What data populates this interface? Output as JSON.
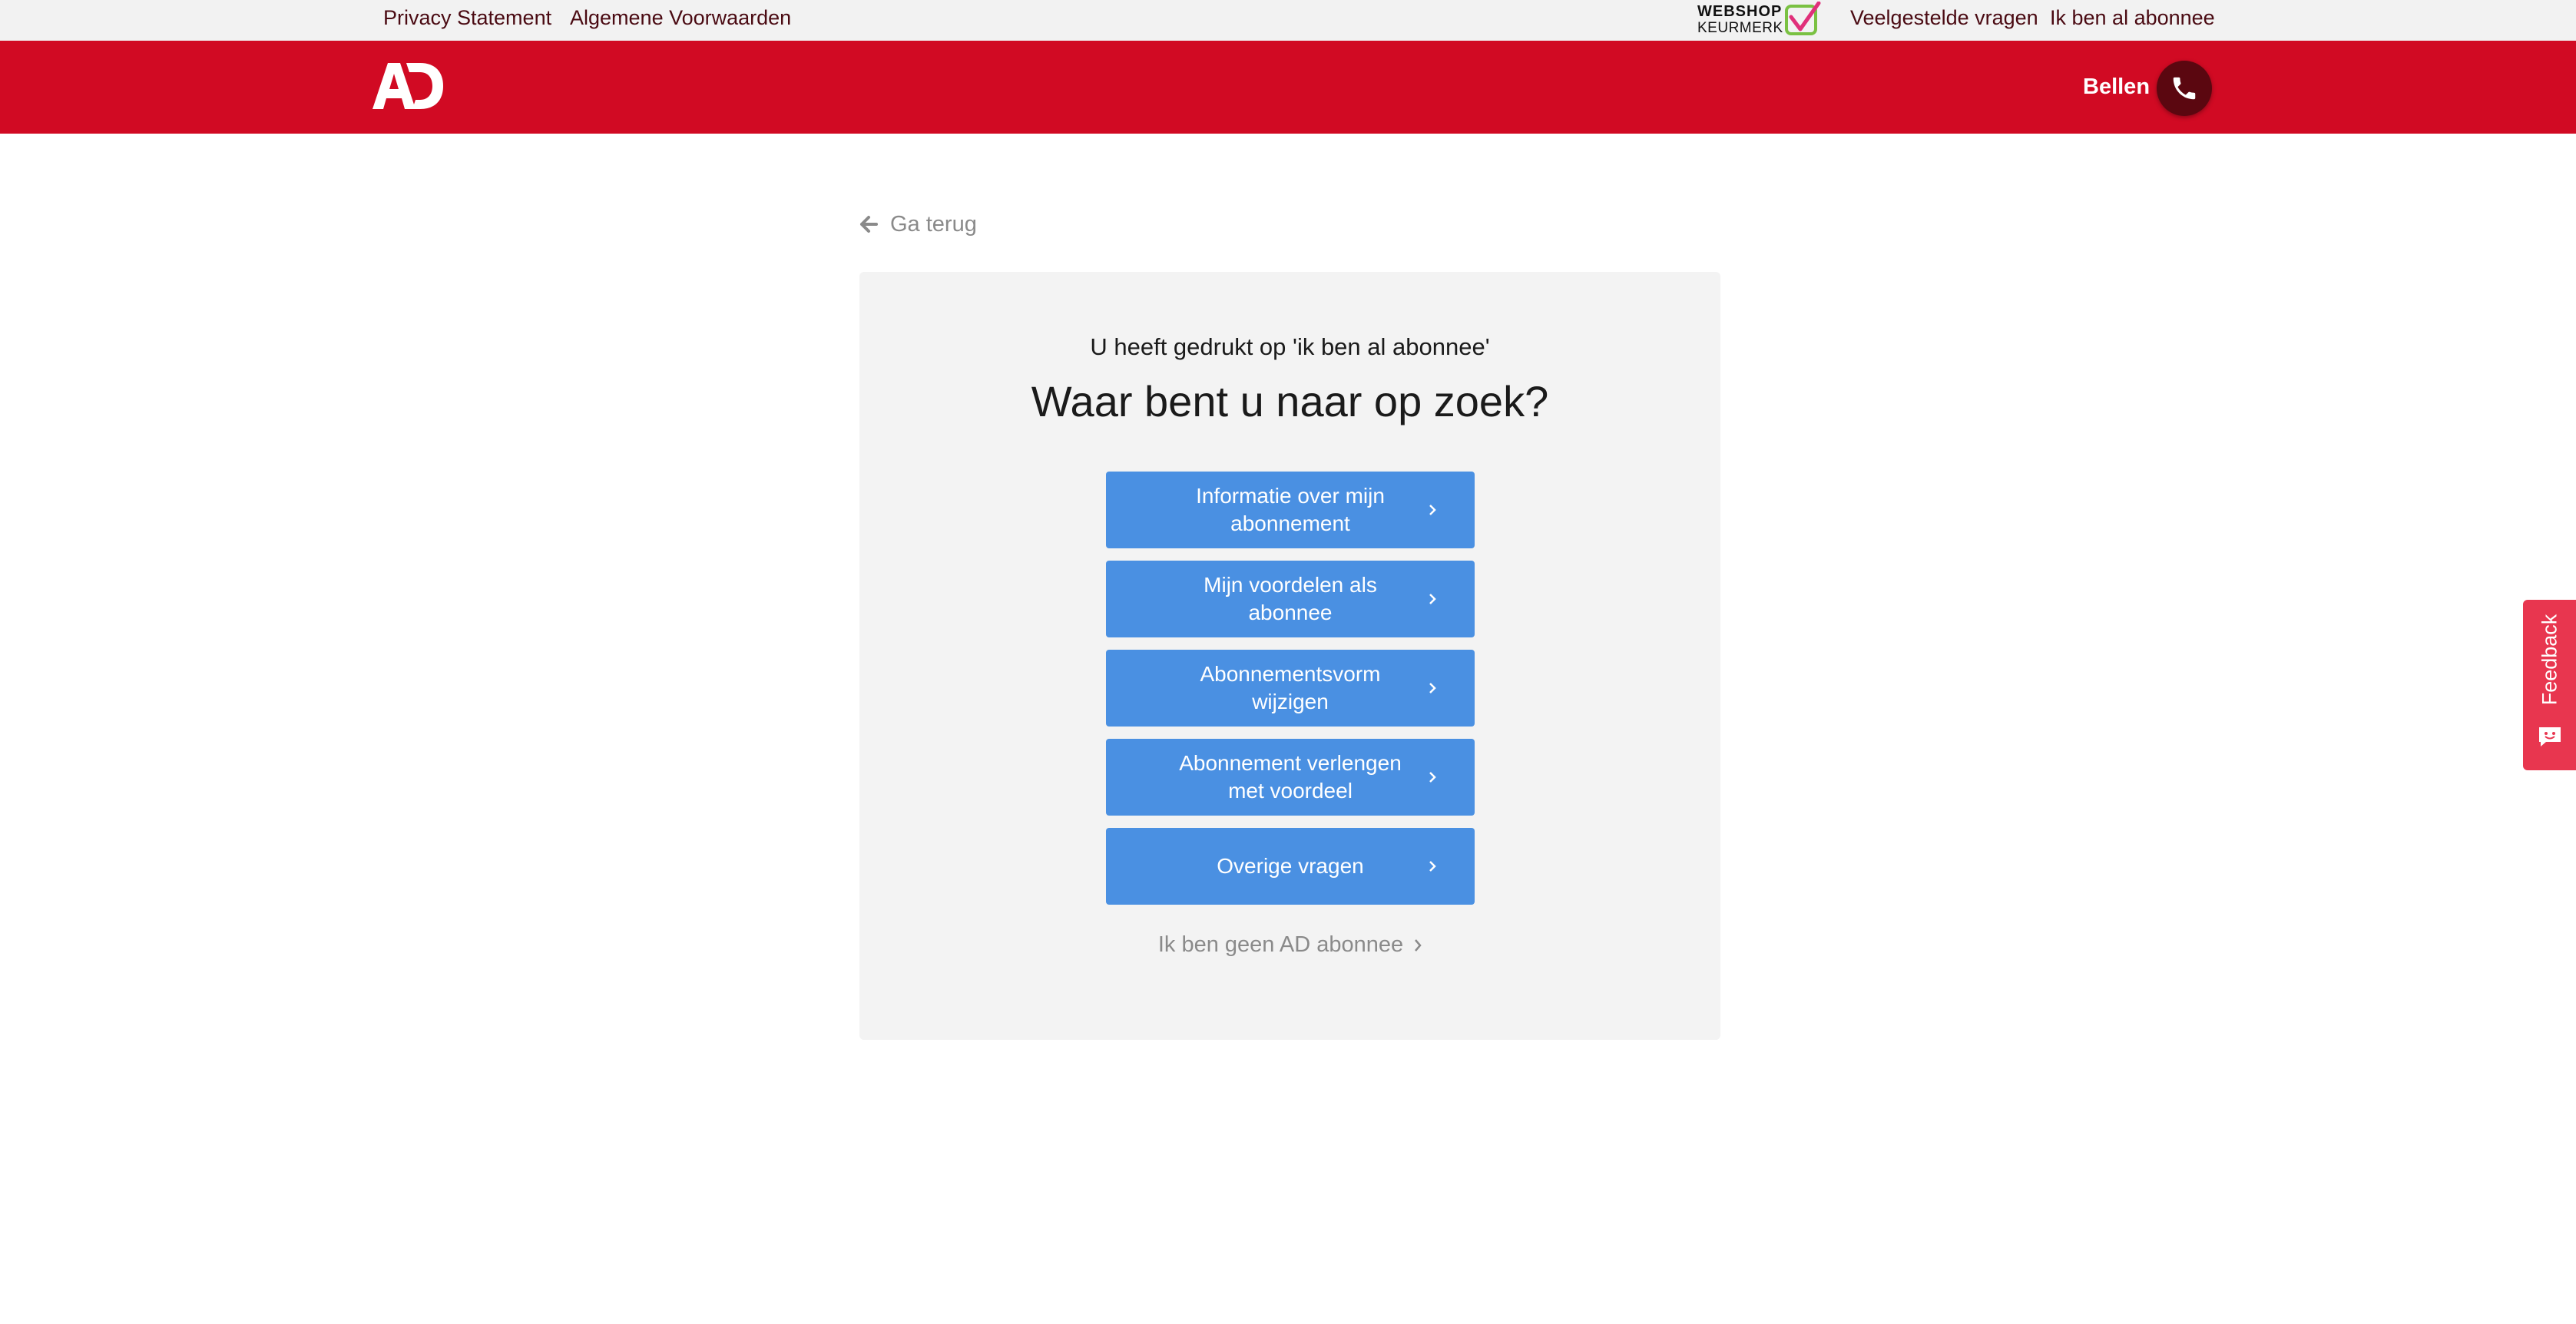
{
  "topbar": {
    "links": {
      "privacy": "Privacy Statement",
      "terms": "Algemene Voorwaarden",
      "faq": "Veelgestelde vragen",
      "subscriber": "Ik ben al abonnee"
    },
    "keurmerk": {
      "line1": "WEBSHOP",
      "line2": "KEURMERK"
    }
  },
  "header": {
    "logo_text": "AD",
    "call_label": "Bellen",
    "brand_color": "#d10a23"
  },
  "back_link": {
    "label": "Ga terug"
  },
  "card": {
    "subtitle": "U heeft gedrukt op 'ik ben al abonnee'",
    "title": "Waar bent u naar op zoek?",
    "options": [
      {
        "label": "Informatie over mijn abonnement"
      },
      {
        "label": "Mijn voordelen als abonnee"
      },
      {
        "label": "Abonnementsvorm wijzigen"
      },
      {
        "label": "Abonnement verlengen met voordeel"
      },
      {
        "label": "Overige vragen"
      }
    ],
    "button_color": "#4a90e2",
    "not_subscriber": "Ik ben geen AD abonnee"
  },
  "feedback": {
    "label": "Feedback",
    "color": "#e8364f"
  }
}
